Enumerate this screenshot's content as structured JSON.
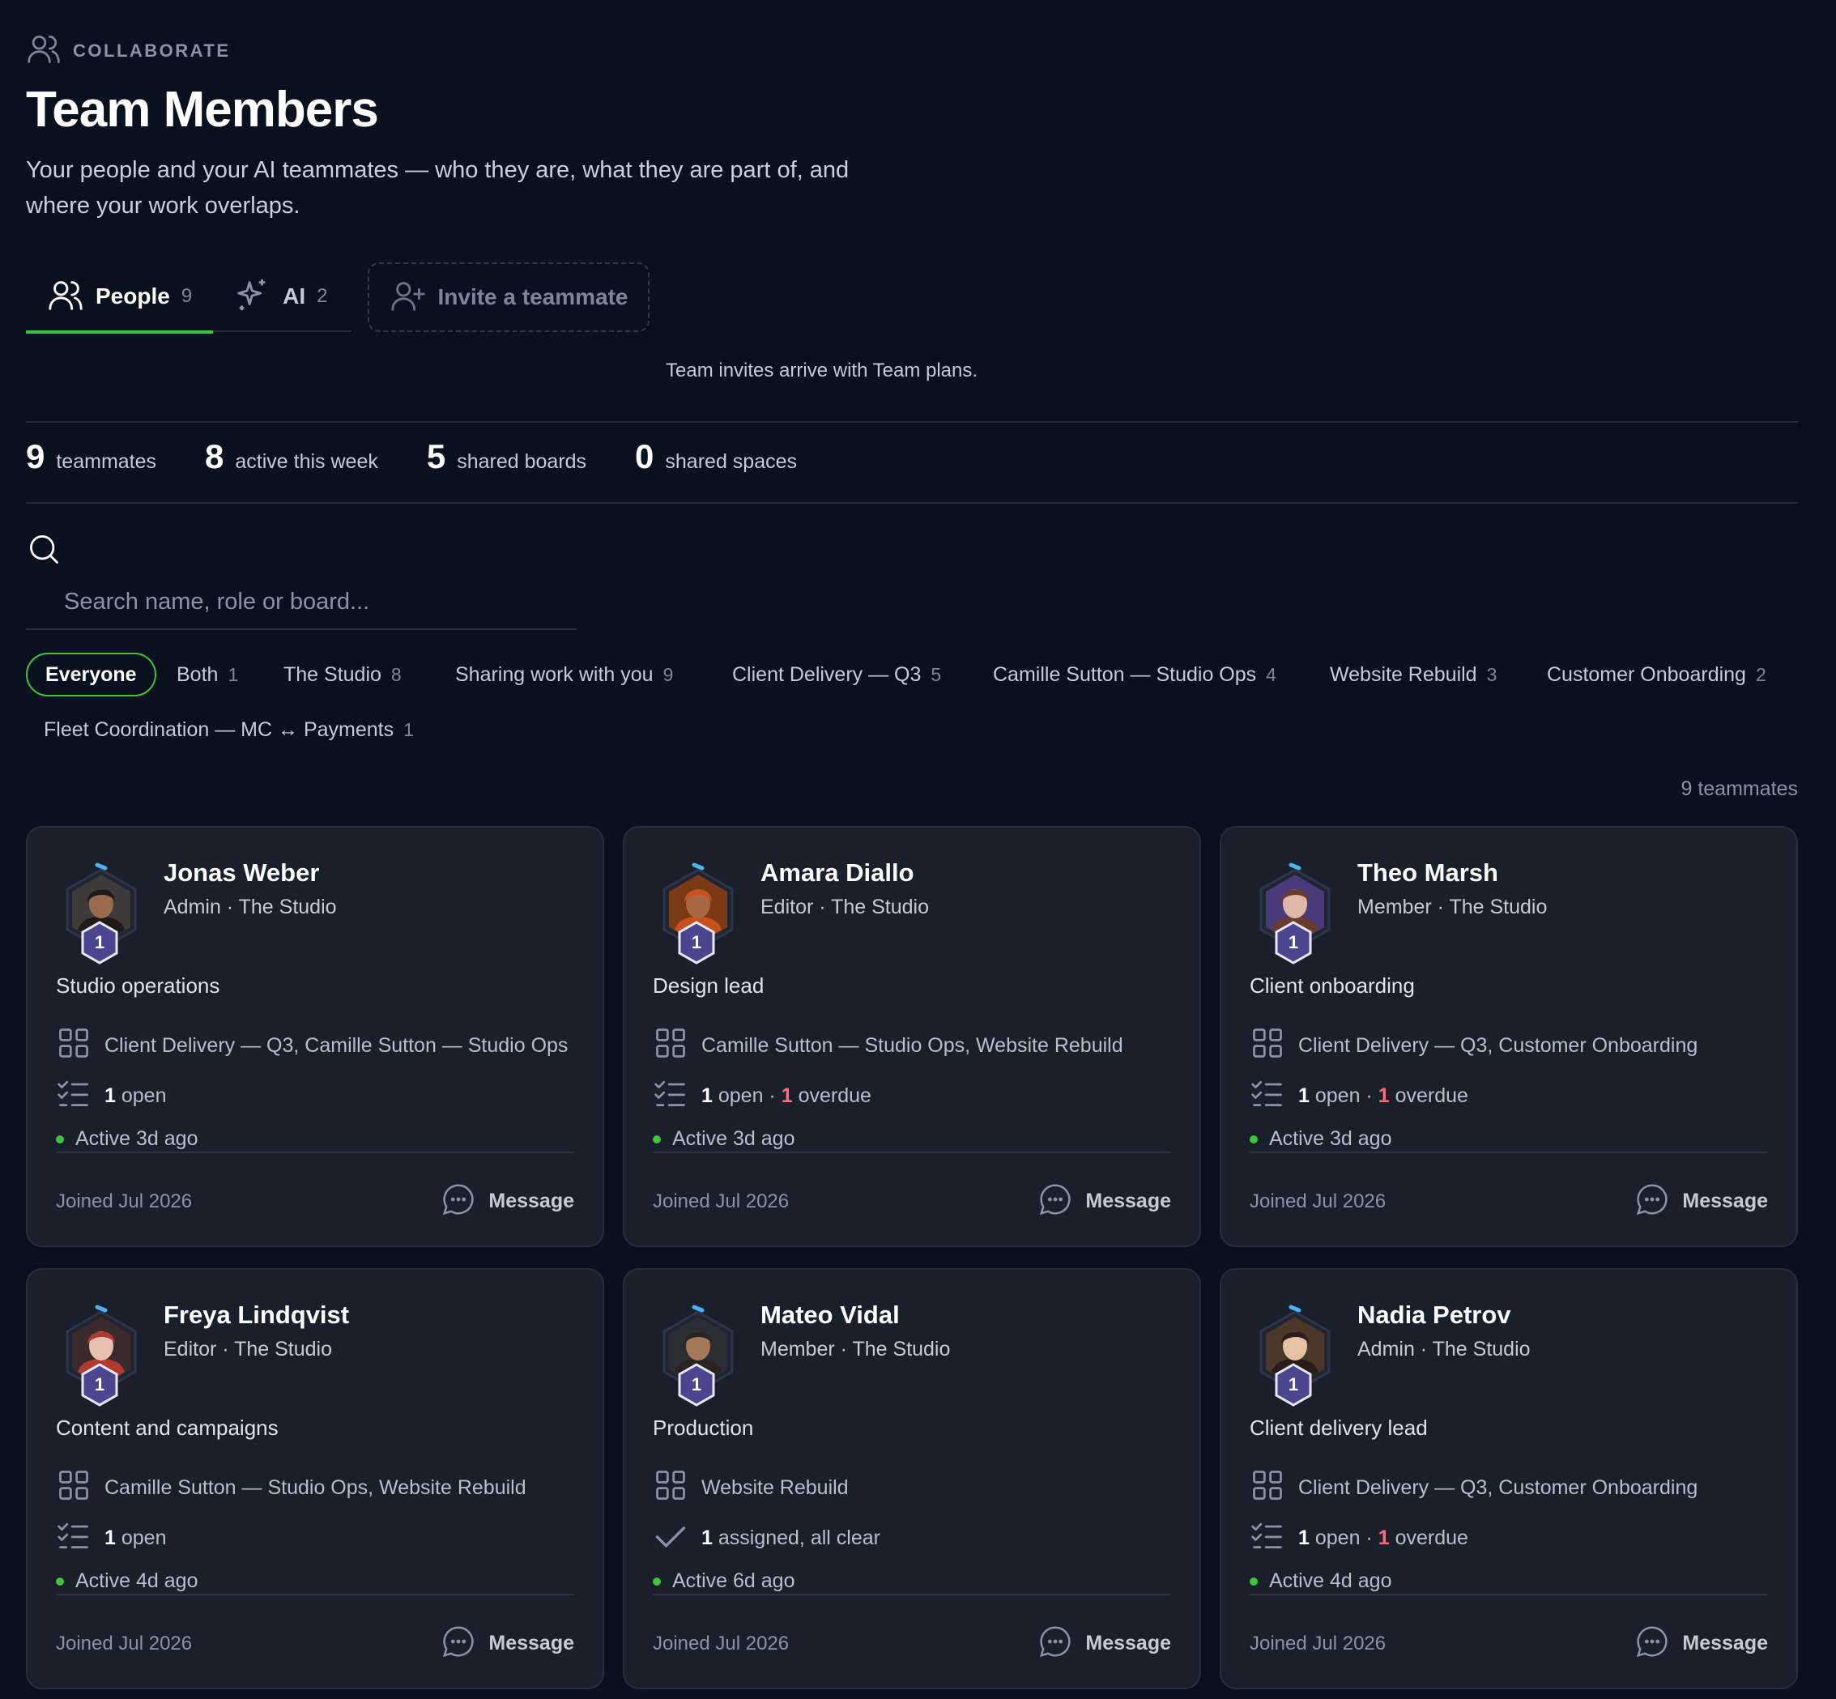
{
  "header": {
    "eyebrow": "COLLABORATE",
    "title": "Team Members",
    "subtitle": "Your people and your AI teammates — who they are, what they are part of, and where your work overlaps."
  },
  "tabs": [
    {
      "label": "People",
      "count": "9",
      "icon": "users-icon"
    },
    {
      "label": "AI",
      "count": "2",
      "icon": "sparkles-icon"
    }
  ],
  "invite": {
    "label": "Invite a teammate",
    "note": "Team invites arrive with Team plans."
  },
  "stats": [
    {
      "num": "9",
      "label": "teammates"
    },
    {
      "num": "8",
      "label": "active this week"
    },
    {
      "num": "5",
      "label": "shared boards"
    },
    {
      "num": "0",
      "label": "shared spaces"
    }
  ],
  "search": {
    "placeholder": "Search name, role or board..."
  },
  "filters": [
    {
      "label": "Everyone",
      "count": ""
    },
    {
      "label": "Both",
      "count": "1"
    },
    {
      "label": "The Studio",
      "count": "8"
    },
    {
      "label": "Sharing work with you",
      "count": "9"
    },
    {
      "label": "Client Delivery — Q3",
      "count": "5"
    },
    {
      "label": "Camille Sutton — Studio Ops",
      "count": "4"
    },
    {
      "label": "Website Rebuild",
      "count": "3"
    },
    {
      "label": "Customer Onboarding",
      "count": "2"
    },
    {
      "label": "Fleet Coordination — MC ↔ Payments",
      "count": "1"
    }
  ],
  "teammates_caption": "9 teammates",
  "members": [
    {
      "name": "Jonas Weber",
      "role": "Admin · The Studio",
      "level": "1",
      "desc": "Studio operations",
      "boards": "Client Delivery — Q3, Camille Sutton — Studio Ops",
      "tasks": {
        "type": "open",
        "open": "1",
        "open_label": "open",
        "overdue": "",
        "overdue_label": ""
      },
      "active": "Active 3d ago",
      "joined": "Joined Jul 2026",
      "message": "Message"
    },
    {
      "name": "Amara Diallo",
      "role": "Editor · The Studio",
      "level": "1",
      "desc": "Design lead",
      "boards": "Camille Sutton — Studio Ops, Website Rebuild",
      "tasks": {
        "type": "overdue",
        "open": "1",
        "open_label": "open ·",
        "overdue": "1",
        "overdue_label": "overdue"
      },
      "active": "Active 3d ago",
      "joined": "Joined Jul 2026",
      "message": "Message"
    },
    {
      "name": "Theo Marsh",
      "role": "Member · The Studio",
      "level": "1",
      "desc": "Client onboarding",
      "boards": "Client Delivery — Q3, Customer Onboarding",
      "tasks": {
        "type": "overdue",
        "open": "1",
        "open_label": "open ·",
        "overdue": "1",
        "overdue_label": "overdue"
      },
      "active": "Active 3d ago",
      "joined": "Joined Jul 2026",
      "message": "Message"
    },
    {
      "name": "Freya Lindqvist",
      "role": "Editor · The Studio",
      "level": "1",
      "desc": "Content and campaigns",
      "boards": "Camille Sutton — Studio Ops, Website Rebuild",
      "tasks": {
        "type": "open",
        "open": "1",
        "open_label": "open",
        "overdue": "",
        "overdue_label": ""
      },
      "active": "Active 4d ago",
      "joined": "Joined Jul 2026",
      "message": "Message"
    },
    {
      "name": "Mateo Vidal",
      "role": "Member · The Studio",
      "level": "1",
      "desc": "Production",
      "boards": "Website Rebuild",
      "tasks": {
        "type": "clear",
        "open": "1",
        "open_label": "assigned, all clear",
        "overdue": "",
        "overdue_label": ""
      },
      "active": "Active 6d ago",
      "joined": "Joined Jul 2026",
      "message": "Message"
    },
    {
      "name": "Nadia Petrov",
      "role": "Admin · The Studio",
      "level": "1",
      "desc": "Client delivery lead",
      "boards": "Client Delivery — Q3, Customer Onboarding",
      "tasks": {
        "type": "overdue",
        "open": "1",
        "open_label": "open ·",
        "overdue": "1",
        "overdue_label": "overdue"
      },
      "active": "Active 4d ago",
      "joined": "Joined Jul 2026",
      "message": "Message"
    }
  ],
  "colors": {
    "accent": "#3fc43a",
    "background": "#0a111e",
    "card": "#1a1f2c",
    "overdue": "#ff6b7f",
    "badge": "#4a4690"
  },
  "avatar_palettes": [
    {
      "bg": "#3c3a3a",
      "skin": "#9a6a4c",
      "hair": "#1e1a18"
    },
    {
      "bg": "#7a3a16",
      "skin": "#a86844",
      "hair": "#c8501a"
    },
    {
      "bg": "#4a3a7a",
      "skin": "#e0b8a6",
      "hair": "#6a3c30"
    },
    {
      "bg": "#3a2a2e",
      "skin": "#e8c0b0",
      "hair": "#b03a2e"
    },
    {
      "bg": "#2c2e36",
      "skin": "#a6785a",
      "hair": "#2a2420"
    },
    {
      "bg": "#4a3828",
      "skin": "#e6c2a4",
      "hair": "#2a1c16"
    }
  ]
}
